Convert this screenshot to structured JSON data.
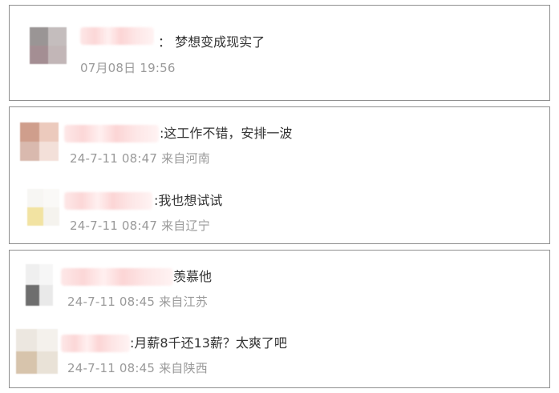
{
  "comments": [
    {
      "text": "：  梦想变成现实了",
      "meta": "07月08日 19:56",
      "avatar_colors": [
        "#9a9595",
        "#c4bdbd",
        "#a48e93",
        "#c2b6b7"
      ]
    },
    {
      "text": ":这工作不错，安排一波",
      "meta": "24-7-11 08:47 来自河南",
      "avatar_colors": [
        "#cf9e8c",
        "#eccabd",
        "#d9b9ae",
        "#f3e0d9"
      ]
    },
    {
      "text": ":我也想试试",
      "meta": "24-7-11 08:47 来自辽宁",
      "avatar_colors": [
        "#f7f6f3",
        "#faf9f7",
        "#f2e3a2",
        "#f5f3ee"
      ]
    },
    {
      "text": "羡慕他",
      "meta": "24-7-11 08:45 来自江苏",
      "avatar_colors": [
        "#efefef",
        "#f6f6f6",
        "#6e6e6e",
        "#e9e9e9"
      ]
    },
    {
      "text": ":月薪8千还13薪？太爽了吧",
      "meta": "24-7-11 08:45 来自陕西",
      "avatar_colors": [
        "#ece7e0",
        "#f4f1ec",
        "#d7c4ac",
        "#e9e2d7"
      ]
    }
  ]
}
